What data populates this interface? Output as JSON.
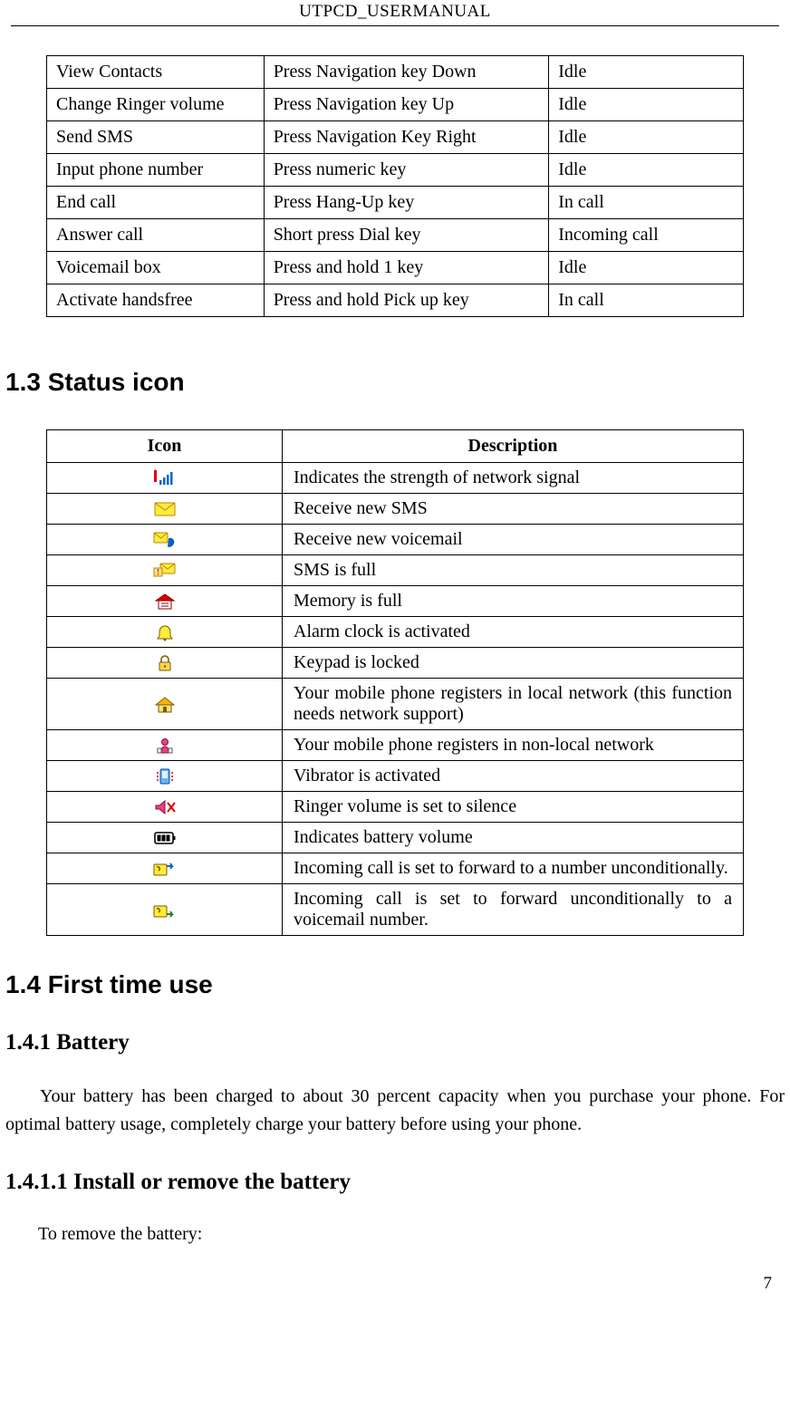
{
  "header": {
    "title": "UTPCD_USERMANUAL"
  },
  "actions_table": {
    "rows": [
      {
        "c1": "View Contacts",
        "c2": "Press Navigation key Down",
        "c3": "Idle"
      },
      {
        "c1": "Change Ringer volume",
        "c2": "Press Navigation key Up",
        "c3": "Idle"
      },
      {
        "c1": "Send SMS",
        "c2": "Press Navigation Key Right",
        "c3": "Idle"
      },
      {
        "c1": "Input phone number",
        "c2": "Press numeric key",
        "c3": "Idle"
      },
      {
        "c1": "End call",
        "c2": "Press Hang-Up key",
        "c3": "In call"
      },
      {
        "c1": "Answer call",
        "c2": "Short press Dial key",
        "c3": "Incoming call"
      },
      {
        "c1": "Voicemail box",
        "c2": "Press and hold 1 key",
        "c3": "Idle"
      },
      {
        "c1": "Activate handsfree",
        "c2": "Press and hold Pick up key",
        "c3": "In call"
      }
    ]
  },
  "sections": {
    "status_icon_heading": "1.3 Status icon",
    "first_time_use_heading": "1.4 First time use",
    "battery_heading": "1.4.1 Battery",
    "install_remove_heading": "1.4.1.1 Install or remove the battery"
  },
  "icons_table": {
    "headers": {
      "icon": "Icon",
      "description": "Description"
    },
    "rows": [
      {
        "icon": "signal-strength-icon",
        "desc": "Indicates the strength of network signal",
        "justify": false
      },
      {
        "icon": "new-sms-icon",
        "desc": "Receive new SMS",
        "justify": false
      },
      {
        "icon": "new-voicemail-icon",
        "desc": "Receive new voicemail",
        "justify": false
      },
      {
        "icon": "sms-full-icon",
        "desc": "SMS is full",
        "justify": false
      },
      {
        "icon": "memory-full-icon",
        "desc": "Memory is full",
        "justify": false
      },
      {
        "icon": "alarm-clock-icon",
        "desc": "Alarm clock is activated",
        "justify": false
      },
      {
        "icon": "keypad-locked-icon",
        "desc": "Keypad is locked",
        "justify": false
      },
      {
        "icon": "local-network-icon",
        "desc": "Your mobile phone registers in local network (this function needs network support)",
        "justify": true
      },
      {
        "icon": "non-local-network-icon",
        "desc": "Your mobile phone registers in non-local network",
        "justify": false
      },
      {
        "icon": "vibrator-icon",
        "desc": "Vibrator is activated",
        "justify": false
      },
      {
        "icon": "silence-icon",
        "desc": "Ringer volume is set to silence",
        "justify": false
      },
      {
        "icon": "battery-icon",
        "desc": "Indicates battery volume",
        "justify": false
      },
      {
        "icon": "forward-number-icon",
        "desc": "Incoming call is set to forward to a number unconditionally.",
        "justify": true
      },
      {
        "icon": "forward-voicemail-icon",
        "desc": "Incoming call is set to forward unconditionally to a voicemail number.",
        "justify": true
      }
    ]
  },
  "paragraphs": {
    "battery_p1": "Your battery has been charged to about 30 percent capacity when you purchase your phone. For optimal battery usage, completely charge your battery before using your phone.",
    "remove_battery": "To remove the battery:"
  },
  "page_number": "7"
}
